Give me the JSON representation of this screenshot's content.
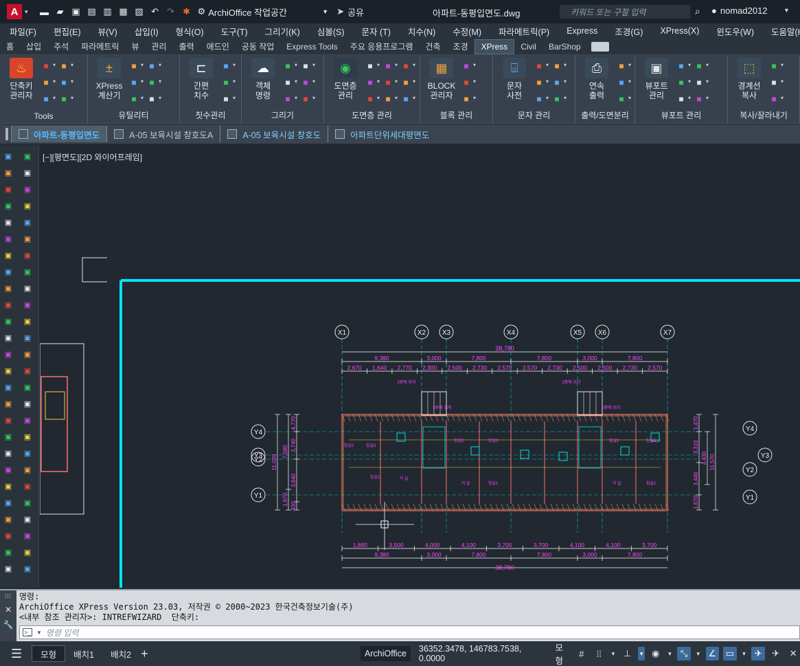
{
  "titlebar": {
    "workspace": "ArchiOffice 작업공간",
    "share": "공유",
    "doc_title": "아파트-동평입면도.dwg",
    "search_placeholder": "키워드 또는 구절 입력",
    "user": "nomad2012"
  },
  "menu": [
    "파일(F)",
    "편집(E)",
    "뷰(V)",
    "삽입(I)",
    "형식(O)",
    "도구(T)",
    "그리기(K)",
    "심볼(S)",
    "문자 (T)",
    "치수(N)",
    "수정(M)",
    "파라메트릭(P)",
    "Express",
    "조경(G)",
    "XPress(X)",
    "윈도우(W)",
    "도움말(H)"
  ],
  "ribbon_tabs": [
    "홈",
    "삽입",
    "주석",
    "파라메트릭",
    "뷰",
    "관리",
    "출력",
    "애드인",
    "공동 작업",
    "Express Tools",
    "주요 응용프로그램",
    "건축",
    "조경",
    "XPress",
    "Civil",
    "BarShop"
  ],
  "ribbon_active_tab": "XPress",
  "ribbon": {
    "groups": [
      {
        "title": "Tools",
        "big": [
          "단축키\n관리자"
        ]
      },
      {
        "title": "유틸리티",
        "big": [
          "XPress\n계산기"
        ]
      },
      {
        "title": "칫수관리",
        "big": [
          "간편\n치수"
        ]
      },
      {
        "title": "그리기",
        "big": [
          "객체\n명령"
        ]
      },
      {
        "title": "도면층 관리",
        "big": [
          "도면층\n관리"
        ]
      },
      {
        "title": "블록 관리",
        "big": [
          "BLOCK\n관리자"
        ]
      },
      {
        "title": "문자 관리",
        "big": [
          "문자\n사전"
        ]
      },
      {
        "title": "출력/도면분리",
        "big": [
          "연속\n출력"
        ]
      },
      {
        "title": "뷰포트 관리",
        "big": [
          "뷰포트\n관리"
        ]
      },
      {
        "title": "복사/잘라내기",
        "big": [
          "경계선\n복사"
        ]
      }
    ]
  },
  "file_tabs": [
    {
      "label": "아파트-동평입면도",
      "active": true
    },
    {
      "label": "A-05 보육시설 창호도A",
      "active": false
    },
    {
      "label": "A-05 보육시설 창호도",
      "active": false
    },
    {
      "label": "아파트단위세대평면도",
      "active": false
    }
  ],
  "view_label": "[−][평면도][2D 와이어프레임]",
  "drawing": {
    "grid_x": [
      "X1",
      "X2",
      "X3",
      "X4",
      "X5",
      "X6",
      "X7"
    ],
    "grid_y_left": [
      "Y4",
      "Y3",
      "Y2",
      "Y1"
    ],
    "grid_y_right": [
      "Y4",
      "Y3",
      "Y2",
      "Y1"
    ],
    "overall_dim": "38,780",
    "top_dims_1": [
      "9,380",
      "3,000",
      "7,800",
      "7,800",
      "3,000",
      "7,800"
    ],
    "top_dims_2": [
      "2,670",
      "1,640",
      "2,770",
      "2,300",
      "2,500",
      "2,730",
      "2,570",
      "2,570",
      "2,730",
      "2,500",
      "2,500",
      "2,730",
      "2,570"
    ],
    "bottom_dims_1": [
      "1,880",
      "3,500",
      "4,000",
      "4,100",
      "3,700",
      "3,700",
      "4,100",
      "4,100",
      "3,700"
    ],
    "bottom_dims_2": [
      "9,380",
      "3,000",
      "7,800",
      "7,800",
      "3,000",
      "7,800"
    ],
    "left_dims": [
      "4,770",
      "3,740",
      "7,580",
      "11,020",
      "3,840",
      "2,410",
      "1,670",
      "430"
    ],
    "right_dims": [
      "1,470",
      "3,310",
      "4,430",
      "11,570",
      "3,440",
      "1,670"
    ],
    "room_labels": [
      "2층에 위치",
      "5층에 위치",
      "2층에 위치",
      "5층에 위치",
      "침실2",
      "침실3",
      "침실1",
      "거 실",
      "침실2",
      "침실3",
      "거 실",
      "침실1",
      "침실2",
      "침실3",
      "거 실",
      "침실1"
    ]
  },
  "command": {
    "title": "명령:",
    "line1": "ArchiOffice XPress Version 23.03, 저작권 © 2000~2023 한국건축정보기술(주)",
    "line2": "<내부 참조 관리자>: INTREFWIZARD  단축키:",
    "input_placeholder": "명령 입력"
  },
  "status": {
    "layout_tabs": [
      "모형",
      "배치1",
      "배치2"
    ],
    "app": "ArchiOffice",
    "coords": "36352.3478, 146783.7538, 0.0000",
    "space": "모형"
  },
  "colors": {
    "canvas": "#212830",
    "border": "#00e5ff",
    "dim": "#ffffff",
    "text": "#ff44ff",
    "wall": "#ff7070",
    "grid": "#00c8c8"
  }
}
